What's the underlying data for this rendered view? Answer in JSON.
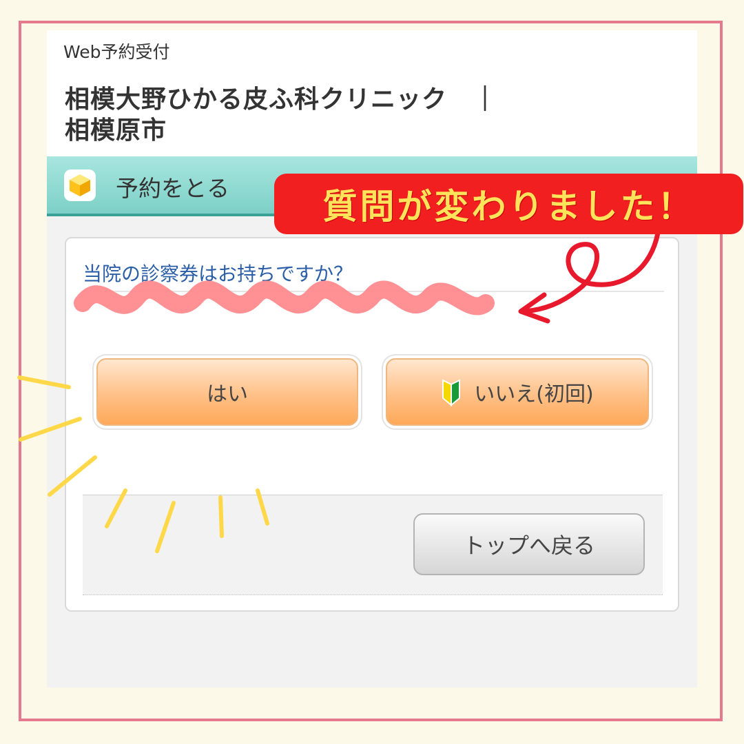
{
  "header": {
    "caption": "Web予約受付",
    "clinic_name": "相模大野ひかる皮ふ科クリニック　｜相模原市"
  },
  "section": {
    "title": "予約をとる",
    "icon": "cube-icon"
  },
  "question": {
    "text": "当院の診察券はお持ちですか？"
  },
  "answers": {
    "yes_label": "はい",
    "no_label": "いいえ(初回)",
    "no_icon": "beginner-mark-icon"
  },
  "footer": {
    "back_label": "トップへ戻る"
  },
  "annotation": {
    "banner_text": "質問が変わりました！",
    "colors": {
      "banner_bg": "#f11f1f",
      "banner_text": "#ffe45b",
      "arrow": "#e8192c",
      "underline": "#ff8a8e",
      "rays": "#ffd84a",
      "frame": "#e57a8e"
    }
  }
}
